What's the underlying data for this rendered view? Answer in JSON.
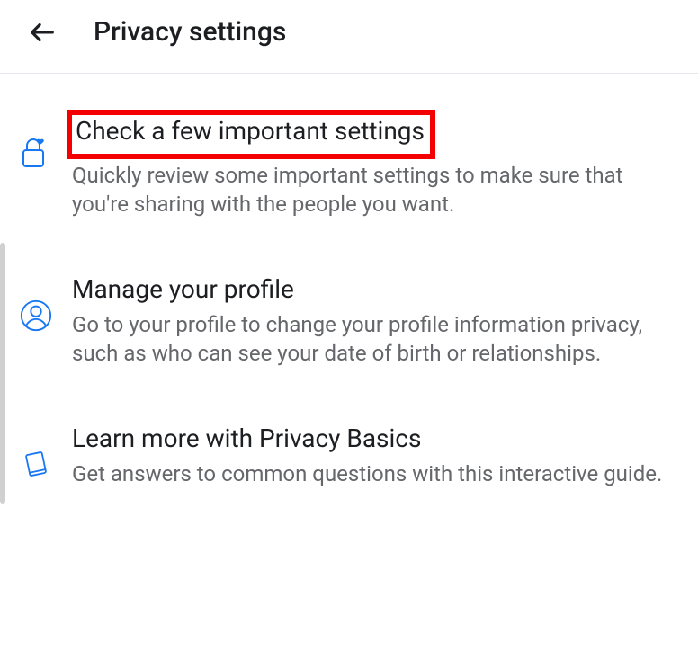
{
  "header": {
    "title": "Privacy settings"
  },
  "items": [
    {
      "title": "Check a few important settings",
      "desc": "Quickly review some important settings to make sure that you're sharing with the people you want.",
      "icon": "lock-heart-icon",
      "highlighted": true
    },
    {
      "title": "Manage your profile",
      "desc": "Go to your profile to change your profile information privacy, such as who can see your date of birth or relationships.",
      "icon": "profile-icon",
      "highlighted": false
    },
    {
      "title": "Learn more with Privacy Basics",
      "desc": "Get answers to common questions with this interactive guide.",
      "icon": "book-icon",
      "highlighted": false
    }
  ],
  "colors": {
    "icon_stroke": "#1877f2",
    "highlight_border": "#f40000",
    "text_primary": "#1c1e21",
    "text_secondary": "#65676b"
  }
}
